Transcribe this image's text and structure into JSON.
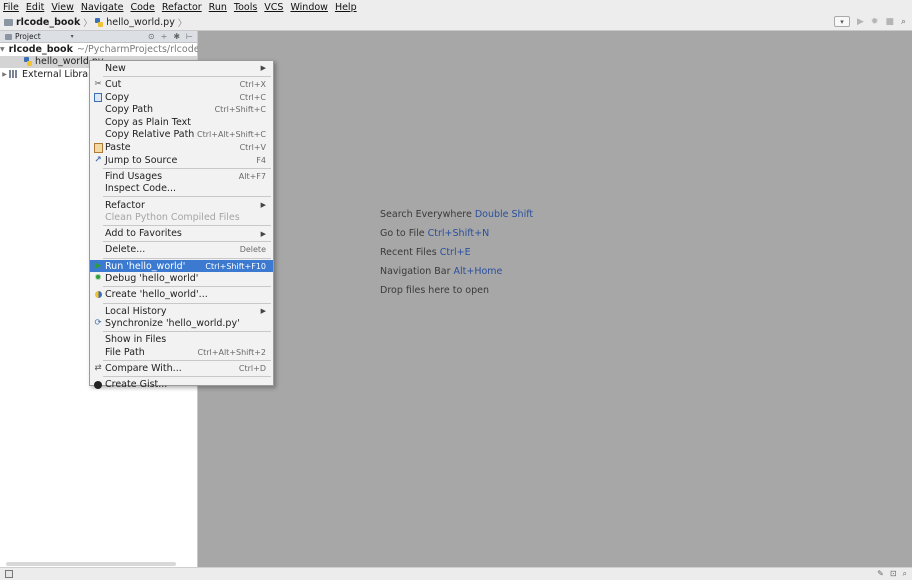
{
  "menubar": [
    "File",
    "Edit",
    "View",
    "Navigate",
    "Code",
    "Refactor",
    "Run",
    "Tools",
    "VCS",
    "Window",
    "Help"
  ],
  "breadcrumb": {
    "project": "rlcode_book",
    "file": "hello_world.py"
  },
  "project_panel": {
    "title": "Project",
    "tree": [
      {
        "label": "rlcode_book",
        "hint": "~/PycharmProjects/rlcode"
      },
      {
        "label": "hello_world.py"
      },
      {
        "label": "External Libraries"
      }
    ]
  },
  "editor_hints": [
    {
      "text": "Search Everywhere",
      "key": "Double Shift"
    },
    {
      "text": "Go to File",
      "key": "Ctrl+Shift+N"
    },
    {
      "text": "Recent Files",
      "key": "Ctrl+E"
    },
    {
      "text": "Navigation Bar",
      "key": "Alt+Home"
    },
    {
      "text": "Drop files here to open",
      "key": ""
    }
  ],
  "context_menu": {
    "items": [
      {
        "label": "New",
        "shortcut": "",
        "submenu": true,
        "icon": ""
      },
      {
        "label": "Cut",
        "shortcut": "Ctrl+X",
        "icon": "scissors-icon"
      },
      {
        "label": "Copy",
        "shortcut": "Ctrl+C",
        "icon": "copy-icon"
      },
      {
        "label": "Copy Path",
        "shortcut": "Ctrl+Shift+C",
        "icon": ""
      },
      {
        "label": "Copy as Plain Text",
        "shortcut": "",
        "icon": ""
      },
      {
        "label": "Copy Relative Path",
        "shortcut": "Ctrl+Alt+Shift+C",
        "icon": ""
      },
      {
        "label": "Paste",
        "shortcut": "Ctrl+V",
        "icon": "paste-icon"
      },
      {
        "label": "Jump to Source",
        "shortcut": "F4",
        "icon": "jump-icon"
      },
      {
        "label": "Find Usages",
        "shortcut": "Alt+F7",
        "icon": ""
      },
      {
        "label": "Inspect Code...",
        "shortcut": "",
        "icon": ""
      },
      {
        "label": "Refactor",
        "shortcut": "",
        "submenu": true,
        "icon": ""
      },
      {
        "label": "Clean Python Compiled Files",
        "shortcut": "",
        "disabled": true,
        "icon": ""
      },
      {
        "label": "Add to Favorites",
        "shortcut": "",
        "submenu": true,
        "icon": ""
      },
      {
        "label": "Delete...",
        "shortcut": "Delete",
        "icon": ""
      },
      {
        "label": "Run 'hello_world'",
        "shortcut": "Ctrl+Shift+F10",
        "highlighted": true,
        "icon": "run-icon"
      },
      {
        "label": "Debug 'hello_world'",
        "shortcut": "",
        "icon": "debug-icon"
      },
      {
        "label": "Create 'hello_world'...",
        "shortcut": "",
        "icon": "python-icon"
      },
      {
        "label": "Local History",
        "shortcut": "",
        "submenu": true,
        "icon": ""
      },
      {
        "label": "Synchronize 'hello_world.py'",
        "shortcut": "",
        "icon": "sync-icon"
      },
      {
        "label": "Show in Files",
        "shortcut": "",
        "icon": ""
      },
      {
        "label": "File Path",
        "shortcut": "Ctrl+Alt+Shift+2",
        "icon": ""
      },
      {
        "label": "Compare With...",
        "shortcut": "Ctrl+D",
        "icon": "compare-icon"
      },
      {
        "label": "Create Gist...",
        "shortcut": "",
        "icon": "github-icon"
      }
    ]
  },
  "colors": {
    "highlight": "#3b7ad0",
    "editor_bg": "#a7a7a7",
    "hint_key": "#2a4f9e"
  }
}
